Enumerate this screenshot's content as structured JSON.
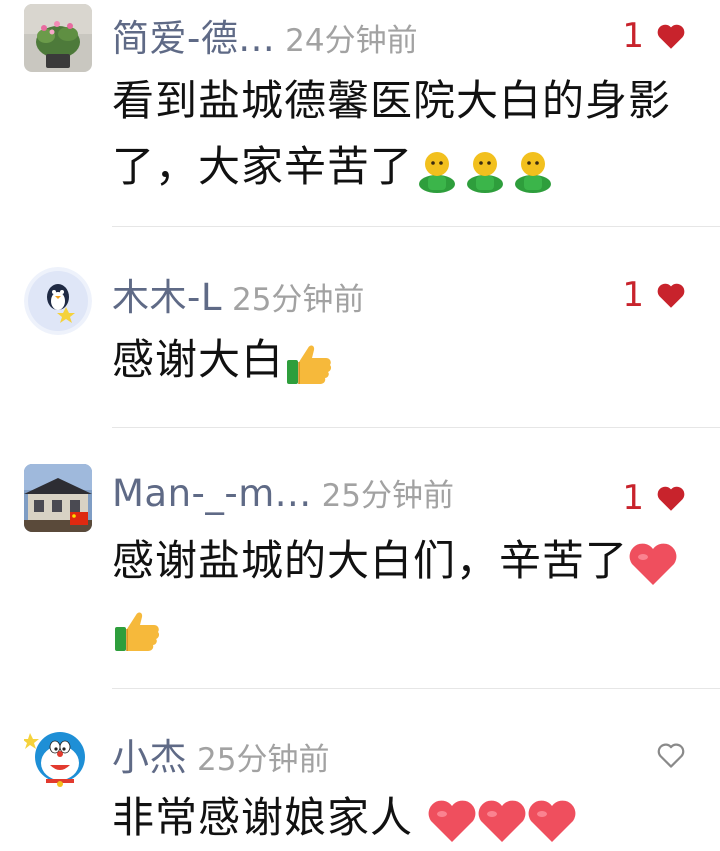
{
  "comments": [
    {
      "user": "简爱-德...",
      "time": "24分钟前",
      "likes": "1",
      "liked": true,
      "text": "看到盐城德馨医院大白的身影了，大家辛苦了",
      "trailing_emoji": [
        "smiley-figure-icon",
        "smiley-figure-icon",
        "smiley-figure-icon"
      ]
    },
    {
      "user": "木木-L",
      "time": "25分钟前",
      "likes": "1",
      "liked": true,
      "text": "感谢大白",
      "trailing_emoji": [
        "thumbs-up-icon"
      ]
    },
    {
      "user": "Man-_-m...",
      "time": "25分钟前",
      "likes": "1",
      "liked": true,
      "text": "感谢盐城的大白们，辛苦了",
      "trailing_emoji": [
        "red-heart-icon",
        "thumbs-up-icon"
      ]
    },
    {
      "user": "小杰",
      "time": "25分钟前",
      "likes": "",
      "liked": false,
      "text": "非常感谢娘家人",
      "trailing_emoji": [
        "red-heart-icon",
        "red-heart-icon",
        "red-heart-icon"
      ]
    }
  ],
  "colors": {
    "username": "#5f6a86",
    "time": "#a2a2a2",
    "like": "#c8232c",
    "text": "#111111",
    "divider": "#e6e6e6"
  }
}
